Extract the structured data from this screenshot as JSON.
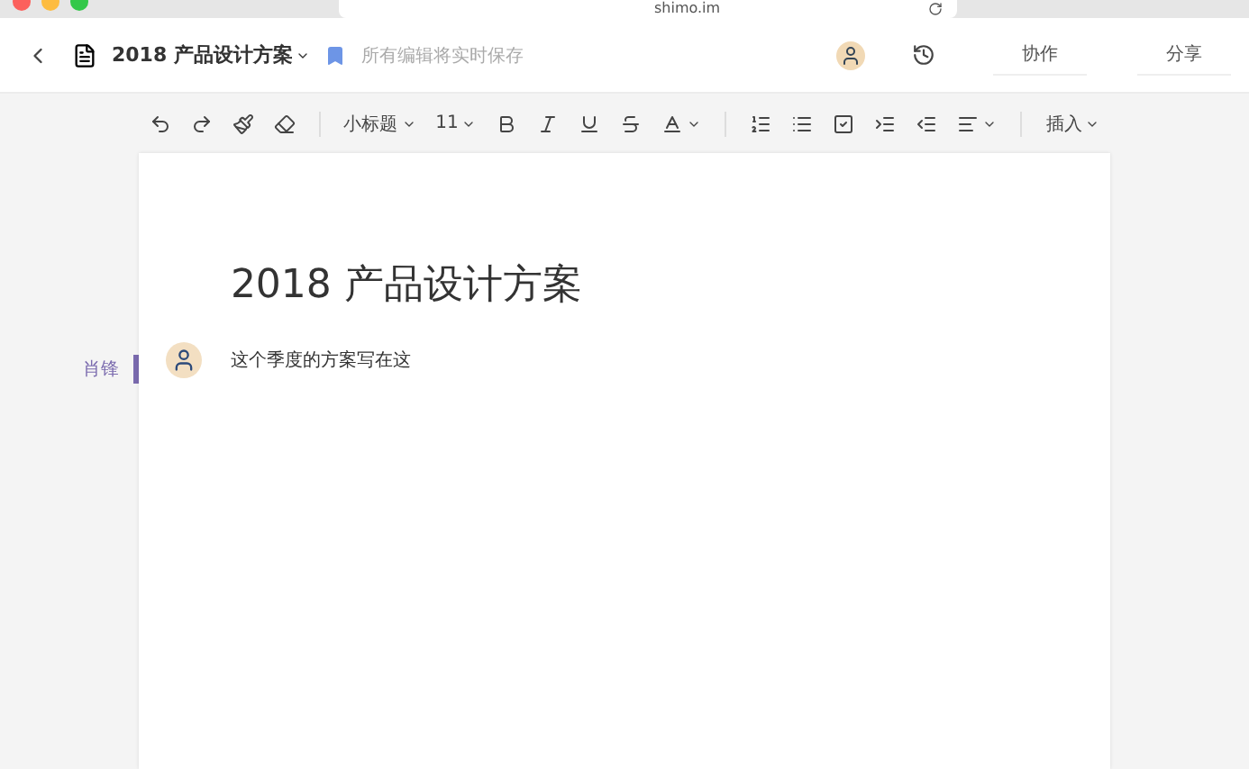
{
  "browser": {
    "url": "shimo.im"
  },
  "header": {
    "doc_title": "2018 产品设计方案",
    "save_status": "所有编辑将实时保存",
    "buttons": [
      "协作",
      "分享"
    ]
  },
  "toolbar": {
    "paragraph_style": "小标题",
    "font_size": "11",
    "insert": "插入"
  },
  "document": {
    "title": "2018 产品设计方案",
    "paragraphs": [
      {
        "author": "肖锋",
        "text": "这个季度的方案写在这"
      }
    ]
  }
}
